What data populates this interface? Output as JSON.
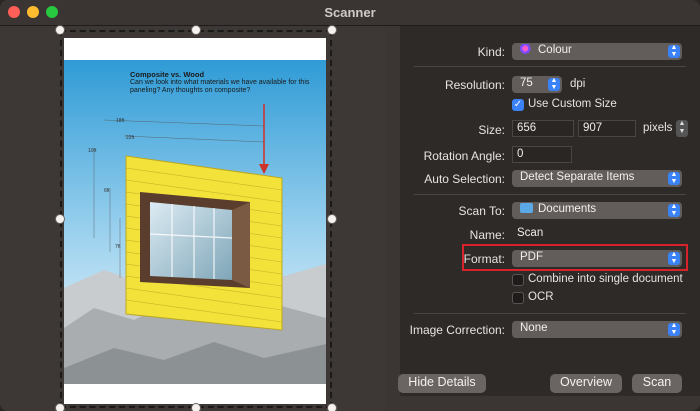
{
  "window": {
    "title": "Scanner"
  },
  "document": {
    "heading": "Composite vs. Wood",
    "subtext": "Can we look into what materials we have available for this paneling? Any thoughts on composite?",
    "dims": [
      "18ft",
      "22ft",
      "10ft",
      "6ft",
      "7ft"
    ]
  },
  "settings": {
    "kind": {
      "label": "Kind:",
      "value": "Colour"
    },
    "resolution": {
      "label": "Resolution:",
      "value": "75",
      "unit": "dpi"
    },
    "custom_size": {
      "label": "Use Custom Size",
      "checked": true
    },
    "size": {
      "label": "Size:",
      "width": "656",
      "height": "907",
      "unit": "pixels"
    },
    "rotation": {
      "label": "Rotation Angle:",
      "value": "0"
    },
    "auto_selection": {
      "label": "Auto Selection:",
      "value": "Detect Separate Items"
    },
    "scan_to": {
      "label": "Scan To:",
      "value": "Documents"
    },
    "name": {
      "label": "Name:",
      "value": "Scan"
    },
    "format": {
      "label": "Format:",
      "value": "PDF"
    },
    "combine": {
      "label": "Combine into single document",
      "checked": false
    },
    "ocr": {
      "label": "OCR",
      "checked": false
    },
    "image_correction": {
      "label": "Image Correction:",
      "value": "None"
    }
  },
  "buttons": {
    "hide_details": "Hide Details",
    "overview": "Overview",
    "scan": "Scan"
  },
  "colors": {
    "accent": "#3b82f6",
    "highlight": "#d9232a"
  }
}
